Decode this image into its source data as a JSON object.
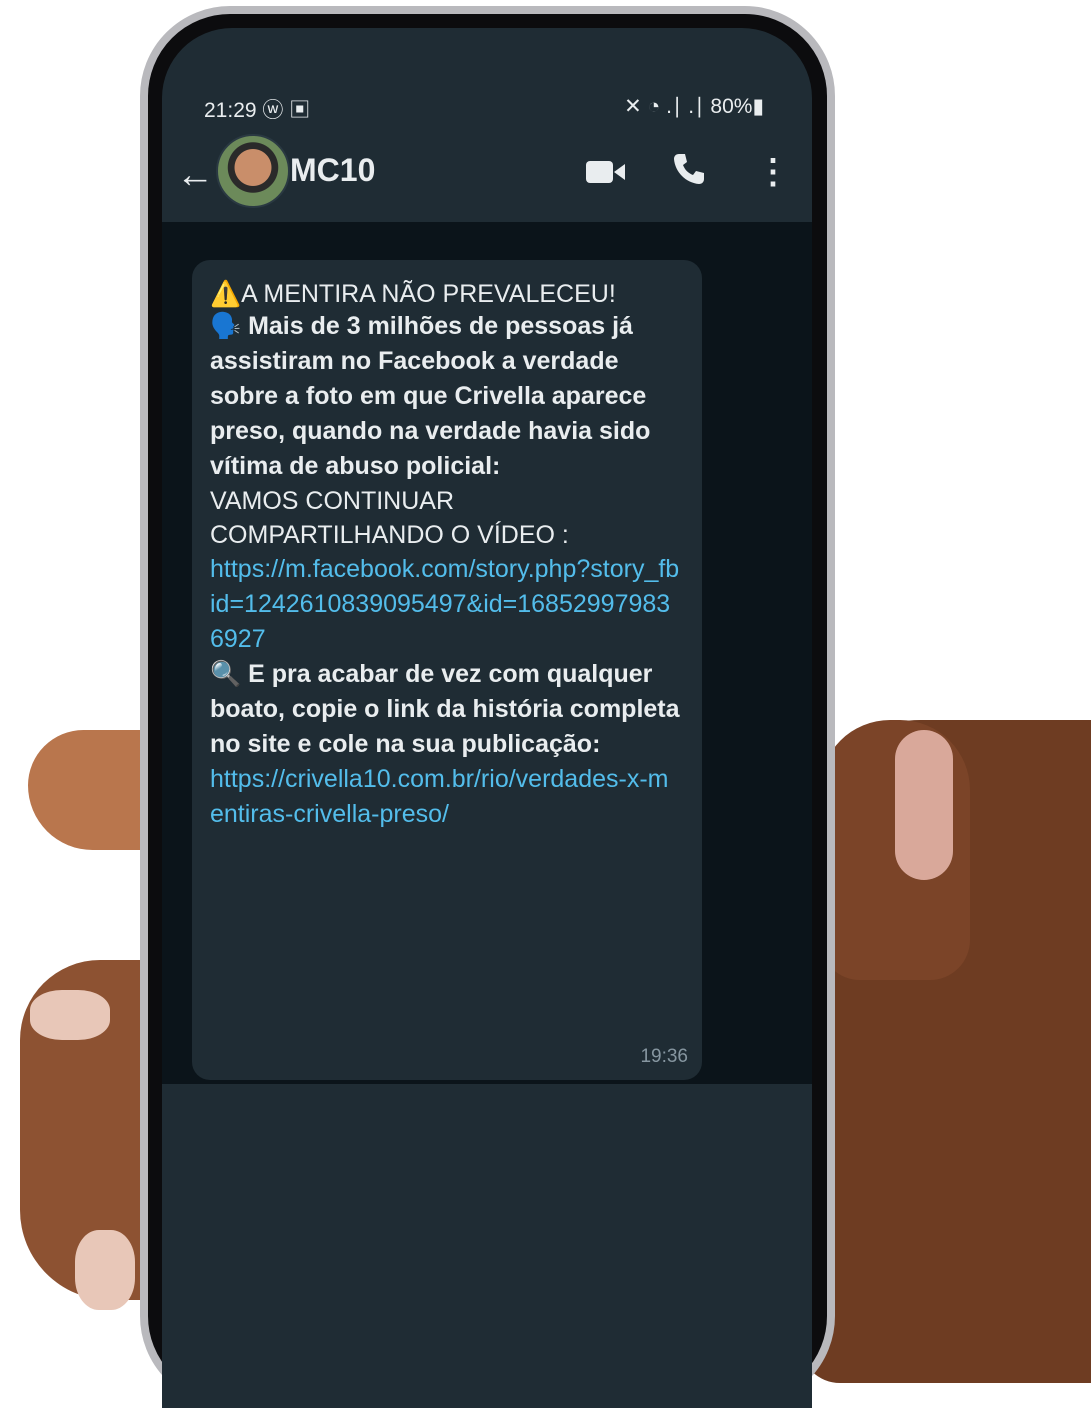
{
  "status_bar": {
    "time": "21:29 ⓦ ▣",
    "right": "✕︎ ◔ .∣ .∣ 80%▮"
  },
  "app_bar": {
    "contact_name": "MC10"
  },
  "message": {
    "heading": "⚠️A MENTIRA NÃO PREVALECEU!",
    "paragraph1": "🗣️ Mais de 3 milhões de pessoas já assistiram no Facebook a verdade sobre a foto em que Crivella aparece preso, quando na verdade havia sido vítima de abuso policial:",
    "call_to_action": "VAMOS CONTINUAR COMPARTILHANDO O VÍDEO :",
    "link1": "https://m.facebook.com/story.php?story_fbid=1242610839095497&id=168529979836927",
    "paragraph2": "🔍 E pra acabar de vez com qualquer boato, copie o link da história completa no site e cole na sua publicação:",
    "link2": "https://crivella10.com.br/rio/verdades-x-mentiras-crivella-preso/",
    "time": "19:36"
  },
  "colors": {
    "screen_bg": "#1f2c34",
    "chat_bg": "#0b141a",
    "link": "#53bdeb",
    "text": "#e9edef"
  }
}
